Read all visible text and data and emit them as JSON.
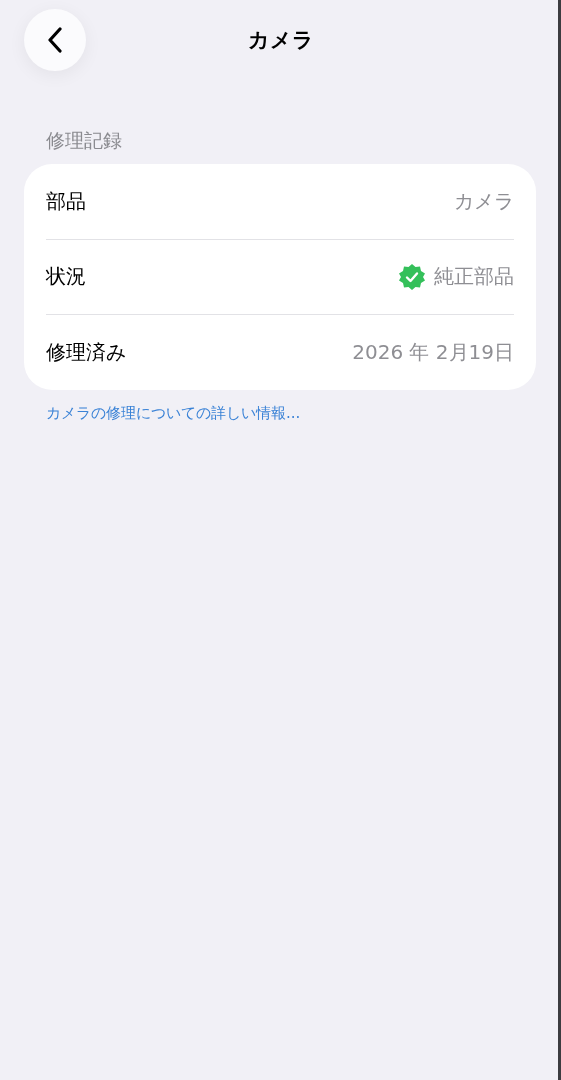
{
  "nav": {
    "title": "カメラ"
  },
  "section": {
    "header": "修理記録",
    "rows": [
      {
        "label": "部品",
        "value": "カメラ",
        "verified": false
      },
      {
        "label": "状況",
        "value": "純正部品",
        "verified": true
      },
      {
        "label": "修理済み",
        "value": "2026 年 2月19日",
        "verified": false
      }
    ]
  },
  "link": "カメラの修理についての詳しい情報..."
}
